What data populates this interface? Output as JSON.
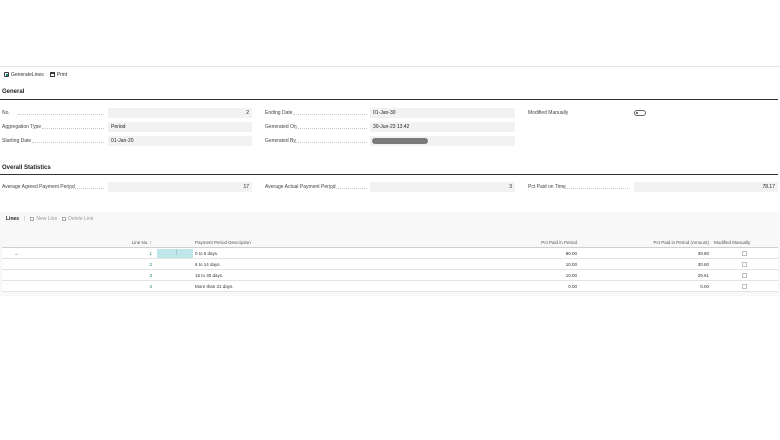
{
  "toolbar": {
    "generate_lines_label": "GenerateLines",
    "print_label": "Print"
  },
  "general": {
    "title": "General",
    "no_label": "No.",
    "no_value": "2",
    "aggregation_type_label": "Aggregation Type",
    "aggregation_type_value": "Period",
    "starting_date_label": "Starting Date",
    "starting_date_value": "01-Jan-20",
    "ending_date_label": "Ending Date",
    "ending_date_value": "01-Jan-30",
    "generated_on_label": "Generated On",
    "generated_on_value": "30-Jun-23 13:42",
    "generated_by_label": "Generated By",
    "modified_manually_label": "Modified Manually",
    "modified_manually_on": false
  },
  "overall": {
    "title": "Overall Statistics",
    "avg_agreed_label": "Average Agreed Payment Period",
    "avg_agreed_value": "17",
    "avg_actual_label": "Average Actual Payment Period",
    "avg_actual_value": "3",
    "pct_paid_label": "Pct Paid on Time",
    "pct_paid_value": "78.17"
  },
  "lines": {
    "title": "Lines",
    "new_line_label": "New Line",
    "delete_line_label": "Delete Line",
    "columns": {
      "line_no": "Line No. ↑",
      "description": "Payment Period Description",
      "pct_paid": "Pct Paid in Period",
      "pct_paid_amount": "Pct Paid in Period (Amount)",
      "modified_manually": "Modified Manually"
    },
    "current_row_marker": "→",
    "row_menu": "⋮",
    "rows": [
      {
        "line_no": "1",
        "description": "0 to 5 days.",
        "pct_paid": "80.00",
        "pct_paid_amount": "39.80",
        "modified": false
      },
      {
        "line_no": "2",
        "description": "6 to 14 days.",
        "pct_paid": "10.00",
        "pct_paid_amount": "30.60",
        "modified": false
      },
      {
        "line_no": "3",
        "description": "15 to 30 days.",
        "pct_paid": "10.00",
        "pct_paid_amount": "29.61",
        "modified": false
      },
      {
        "line_no": "4",
        "description": "More than 31 days.",
        "pct_paid": "0.00",
        "pct_paid_amount": "0.00",
        "modified": false
      }
    ]
  }
}
